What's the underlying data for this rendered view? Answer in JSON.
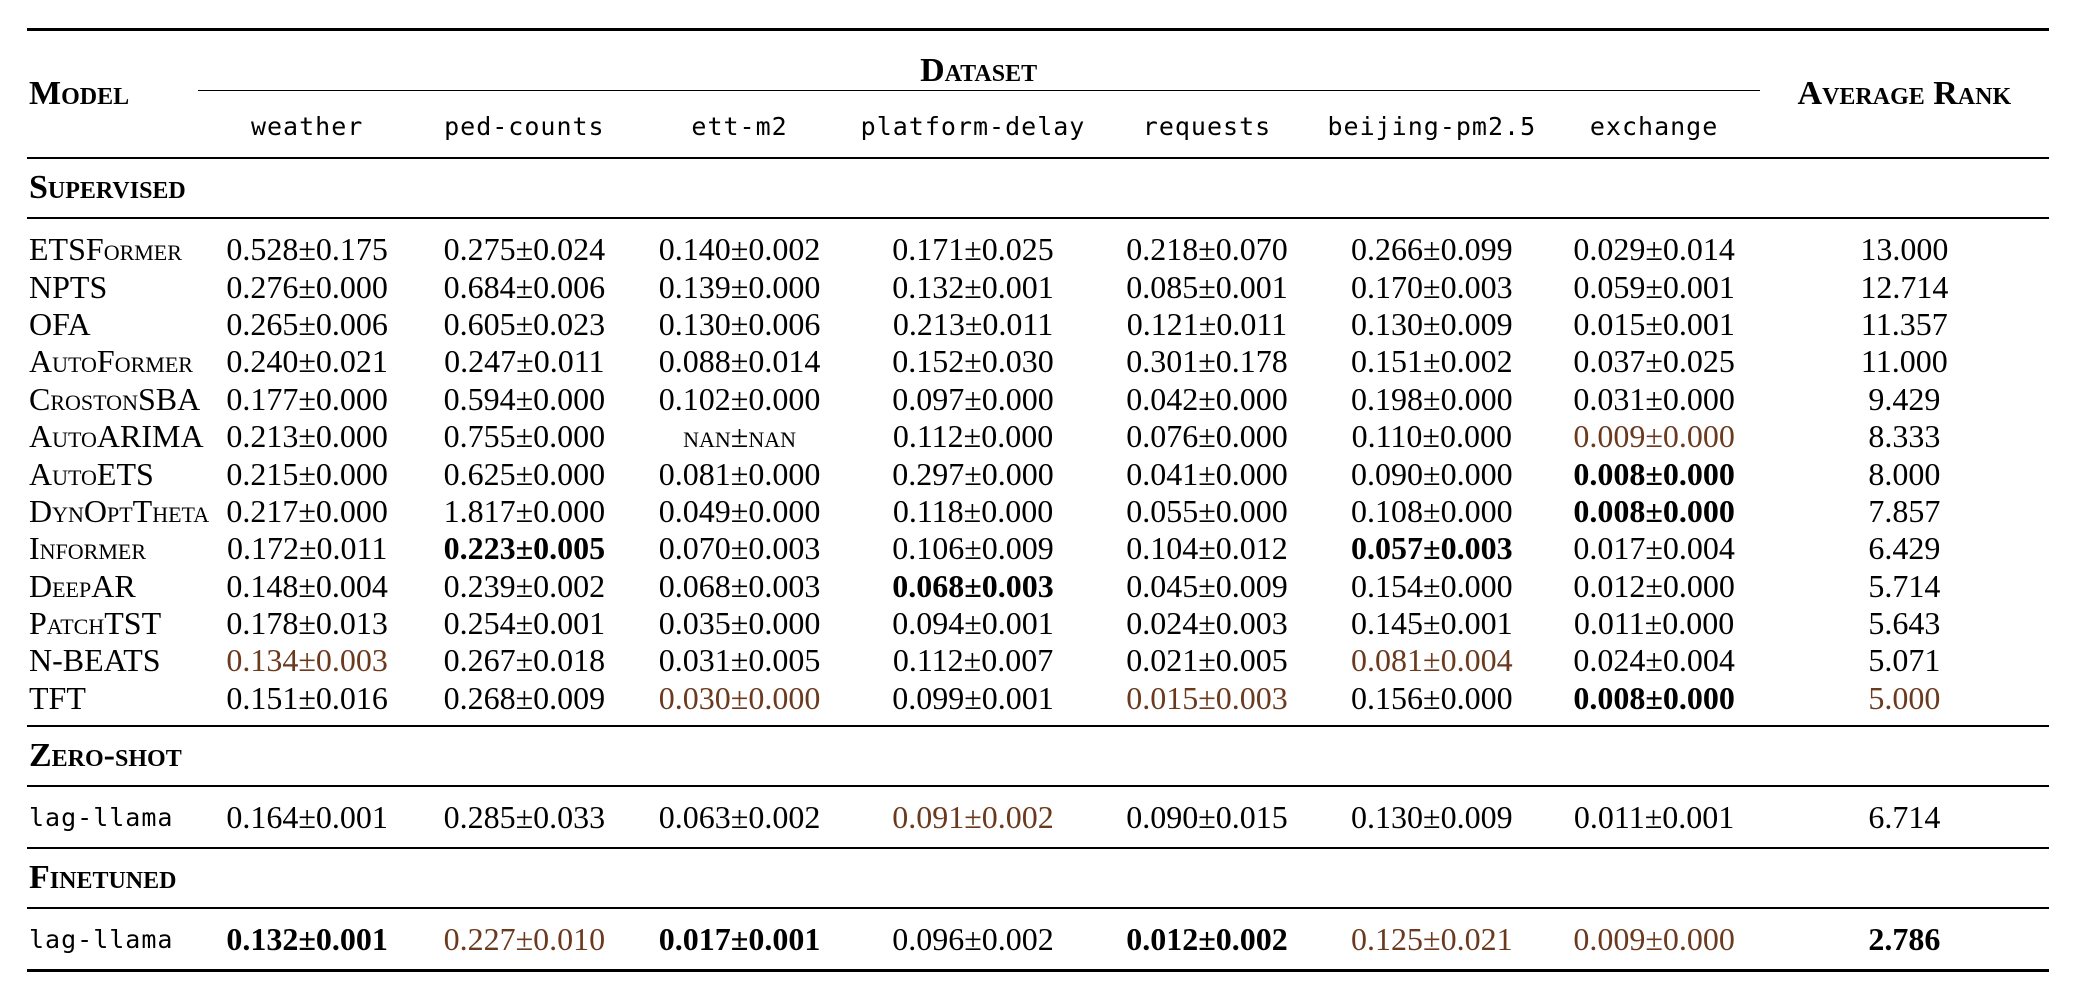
{
  "header": {
    "model": "Model",
    "dataset": "Dataset",
    "average_rank": "Average Rank",
    "columns": [
      "weather",
      "ped-counts",
      "ett-m2",
      "platform-delay",
      "requests",
      "beijing-pm2.5",
      "exchange"
    ]
  },
  "sections": {
    "supervised": "Supervised",
    "zero_shot": "Zero-shot",
    "finetuned": "Finetuned"
  },
  "emphasis_colors": {
    "best": "#000000",
    "second": "#6b3a1e"
  },
  "supervised_rows": [
    {
      "model": "ETSFormer",
      "cells": [
        "0.528±0.175",
        "0.275±0.024",
        "0.140±0.002",
        "0.171±0.025",
        "0.218±0.070",
        "0.266±0.099",
        "0.029±0.014"
      ],
      "rank": "13.000"
    },
    {
      "model": "NPTS",
      "cells": [
        "0.276±0.000",
        "0.684±0.006",
        "0.139±0.000",
        "0.132±0.001",
        "0.085±0.001",
        "0.170±0.003",
        "0.059±0.001"
      ],
      "rank": "12.714"
    },
    {
      "model": "OFA",
      "cells": [
        "0.265±0.006",
        "0.605±0.023",
        "0.130±0.006",
        "0.213±0.011",
        "0.121±0.011",
        "0.130±0.009",
        "0.015±0.001"
      ],
      "rank": "11.357"
    },
    {
      "model": "AutoFormer",
      "cells": [
        "0.240±0.021",
        "0.247±0.011",
        "0.088±0.014",
        "0.152±0.030",
        "0.301±0.178",
        "0.151±0.002",
        "0.037±0.025"
      ],
      "rank": "11.000"
    },
    {
      "model": "CrostonSBA",
      "cells": [
        "0.177±0.000",
        "0.594±0.000",
        "0.102±0.000",
        "0.097±0.000",
        "0.042±0.000",
        "0.198±0.000",
        "0.031±0.000"
      ],
      "rank": "9.429"
    },
    {
      "model": "AutoARIMA",
      "cells": [
        "0.213±0.000",
        "0.755±0.000",
        "nan±nan",
        "0.112±0.000",
        "0.076±0.000",
        "0.110±0.000",
        "0.009±0.000"
      ],
      "rank": "8.333"
    },
    {
      "model": "AutoETS",
      "cells": [
        "0.215±0.000",
        "0.625±0.000",
        "0.081±0.000",
        "0.297±0.000",
        "0.041±0.000",
        "0.090±0.000",
        "0.008±0.000"
      ],
      "rank": "8.000"
    },
    {
      "model": "DynOptTheta",
      "cells": [
        "0.217±0.000",
        "1.817±0.000",
        "0.049±0.000",
        "0.118±0.000",
        "0.055±0.000",
        "0.108±0.000",
        "0.008±0.000"
      ],
      "rank": "7.857"
    },
    {
      "model": "Informer",
      "cells": [
        "0.172±0.011",
        "0.223±0.005",
        "0.070±0.003",
        "0.106±0.009",
        "0.104±0.012",
        "0.057±0.003",
        "0.017±0.004"
      ],
      "rank": "6.429"
    },
    {
      "model": "DeepAR",
      "cells": [
        "0.148±0.004",
        "0.239±0.002",
        "0.068±0.003",
        "0.068±0.003",
        "0.045±0.009",
        "0.154±0.000",
        "0.012±0.000"
      ],
      "rank": "5.714"
    },
    {
      "model": "PatchTST",
      "cells": [
        "0.178±0.013",
        "0.254±0.001",
        "0.035±0.000",
        "0.094±0.001",
        "0.024±0.003",
        "0.145±0.001",
        "0.011±0.000"
      ],
      "rank": "5.643"
    },
    {
      "model": "N-BEATS",
      "cells": [
        "0.134±0.003",
        "0.267±0.018",
        "0.031±0.005",
        "0.112±0.007",
        "0.021±0.005",
        "0.081±0.004",
        "0.024±0.004"
      ],
      "rank": "5.071"
    },
    {
      "model": "TFT",
      "cells": [
        "0.151±0.016",
        "0.268±0.009",
        "0.030±0.000",
        "0.099±0.001",
        "0.015±0.003",
        "0.156±0.000",
        "0.008±0.000"
      ],
      "rank": "5.000"
    }
  ],
  "zero_shot_row": {
    "model": "lag-llama",
    "cells": [
      "0.164±0.001",
      "0.285±0.033",
      "0.063±0.002",
      "0.091±0.002",
      "0.090±0.015",
      "0.130±0.009",
      "0.011±0.001"
    ],
    "rank": "6.714"
  },
  "finetuned_row": {
    "model": "lag-llama",
    "cells": [
      "0.132±0.001",
      "0.227±0.010",
      "0.017±0.001",
      "0.096±0.002",
      "0.012±0.002",
      "0.125±0.021",
      "0.009±0.000"
    ],
    "rank": "2.786"
  }
}
